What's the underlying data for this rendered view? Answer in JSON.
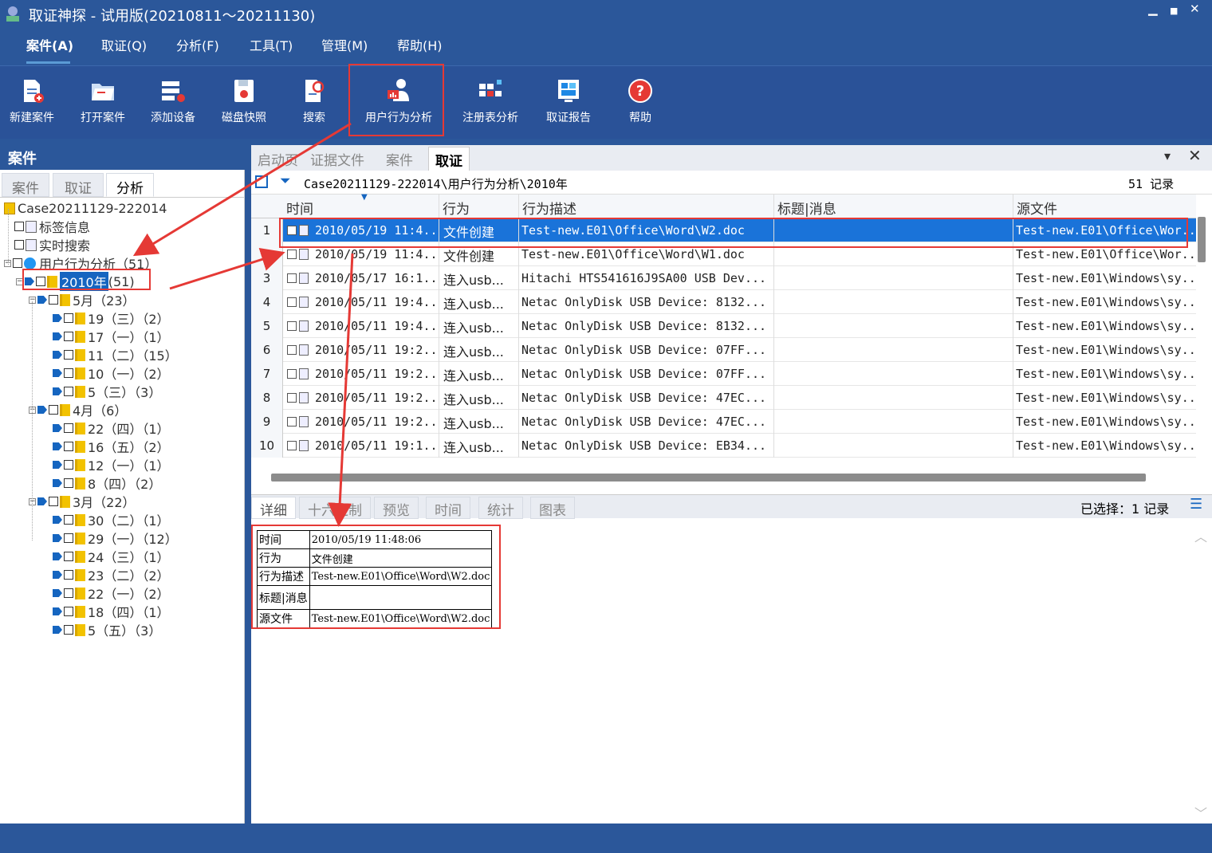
{
  "window": {
    "title": "取证神探 - 试用版(20210811～20211130)",
    "min": "▁",
    "max": "■",
    "close": "✕"
  },
  "menu": [
    {
      "label": "案件(A)",
      "active": true
    },
    {
      "label": "取证(Q)"
    },
    {
      "label": "分析(F)"
    },
    {
      "label": "工具(T)"
    },
    {
      "label": "管理(M)"
    },
    {
      "label": "帮助(H)"
    }
  ],
  "ribbon": [
    {
      "label": "新建案件",
      "icon": "new-case-icon"
    },
    {
      "label": "打开案件",
      "icon": "open-case-icon"
    },
    {
      "label": "添加设备",
      "icon": "add-device-icon"
    },
    {
      "label": "磁盘快照",
      "icon": "disk-snapshot-icon"
    },
    {
      "label": "搜索",
      "icon": "search-doc-icon"
    },
    {
      "label": "用户行为分析",
      "icon": "user-behavior-icon"
    },
    {
      "label": "注册表分析",
      "icon": "registry-icon"
    },
    {
      "label": "取证报告",
      "icon": "report-icon"
    },
    {
      "label": "帮助",
      "icon": "help-icon"
    }
  ],
  "left": {
    "header": "案件",
    "tabs": [
      "案件",
      "取证",
      "分析"
    ],
    "tree": {
      "root": "Case20211129-222014",
      "tag_info": "标签信息",
      "realtime_search": "实时搜索",
      "user_behavior": "用户行为分析（51）",
      "year_label": "2010年",
      "year_count": "(51)",
      "months": [
        {
          "label": "5月（23）",
          "days": [
            "19（三）（2）",
            "17（一）（1）",
            "11（二）（15）",
            "10（一）（2）",
            "5（三）（3）"
          ]
        },
        {
          "label": "4月（6）",
          "days": [
            "22（四）（1）",
            "16（五）（2）",
            "12（一）（1）",
            "8（四）（2）"
          ]
        },
        {
          "label": "3月（22）",
          "days": [
            "30（二）（1）",
            "29（一）（12）",
            "24（三）（1）",
            "23（二）（2）",
            "22（一）（2）",
            "18（四）（1）",
            "5（五）（3）"
          ]
        }
      ]
    }
  },
  "right": {
    "tabs": [
      "启动页",
      "证据文件",
      "案件",
      "取证"
    ],
    "path": "Case20211129-222014\\用户行为分析\\2010年",
    "record_count": "51 记录",
    "columns": [
      "时间",
      "行为",
      "行为描述",
      "标题|消息",
      "源文件"
    ],
    "rows": [
      {
        "no": "1",
        "time": "2010/05/19 11:4...",
        "action": "文件创建",
        "desc": "Test-new.E01\\Office\\Word\\W2.doc",
        "msg": "",
        "src": "Test-new.E01\\Office\\Wor..."
      },
      {
        "no": "2",
        "time": "2010/05/19 11:4...",
        "action": "文件创建",
        "desc": "Test-new.E01\\Office\\Word\\W1.doc",
        "msg": "",
        "src": "Test-new.E01\\Office\\Wor..."
      },
      {
        "no": "3",
        "time": "2010/05/17 16:1...",
        "action": "连入usb...",
        "desc": "Hitachi HTS541616J9SA00 USB Dev...",
        "msg": "",
        "src": "Test-new.E01\\Windows\\sy..."
      },
      {
        "no": "4",
        "time": "2010/05/11 19:4...",
        "action": "连入usb...",
        "desc": "Netac OnlyDisk USB Device: 8132...",
        "msg": "",
        "src": "Test-new.E01\\Windows\\sy..."
      },
      {
        "no": "5",
        "time": "2010/05/11 19:4...",
        "action": "连入usb...",
        "desc": "Netac OnlyDisk USB Device: 8132...",
        "msg": "",
        "src": "Test-new.E01\\Windows\\sy..."
      },
      {
        "no": "6",
        "time": "2010/05/11 19:2...",
        "action": "连入usb...",
        "desc": "Netac OnlyDisk USB Device: 07FF...",
        "msg": "",
        "src": "Test-new.E01\\Windows\\sy..."
      },
      {
        "no": "7",
        "time": "2010/05/11 19:2...",
        "action": "连入usb...",
        "desc": "Netac OnlyDisk USB Device: 07FF...",
        "msg": "",
        "src": "Test-new.E01\\Windows\\sy..."
      },
      {
        "no": "8",
        "time": "2010/05/11 19:2...",
        "action": "连入usb...",
        "desc": "Netac OnlyDisk USB Device: 47EC...",
        "msg": "",
        "src": "Test-new.E01\\Windows\\sy..."
      },
      {
        "no": "9",
        "time": "2010/05/11 19:2...",
        "action": "连入usb...",
        "desc": "Netac OnlyDisk USB Device: 47EC...",
        "msg": "",
        "src": "Test-new.E01\\Windows\\sy..."
      },
      {
        "no": "10",
        "time": "2010/05/11 19:1...",
        "action": "连入usb...",
        "desc": "Netac OnlyDisk USB Device: EB34...",
        "msg": "",
        "src": "Test-new.E01\\Windows\\sy..."
      }
    ],
    "bottom_tabs": [
      "详细",
      "十六进制",
      "预览",
      "时间",
      "统计",
      "图表"
    ],
    "selected_count": "已选择：1 记录",
    "detail": [
      {
        "k": "时间",
        "v": "2010/05/19 11:48:06"
      },
      {
        "k": "行为",
        "v": "文件创建"
      },
      {
        "k": "行为描述",
        "v": "Test-new.E01\\Office\\Word\\W2.doc"
      },
      {
        "k": "标题|消息",
        "v": ""
      },
      {
        "k": "源文件",
        "v": "Test-new.E01\\Office\\Word\\W2.doc"
      }
    ]
  },
  "colors": {
    "accent": "#2b579a",
    "selection": "#1a73d9",
    "highlight": "#e53935"
  }
}
